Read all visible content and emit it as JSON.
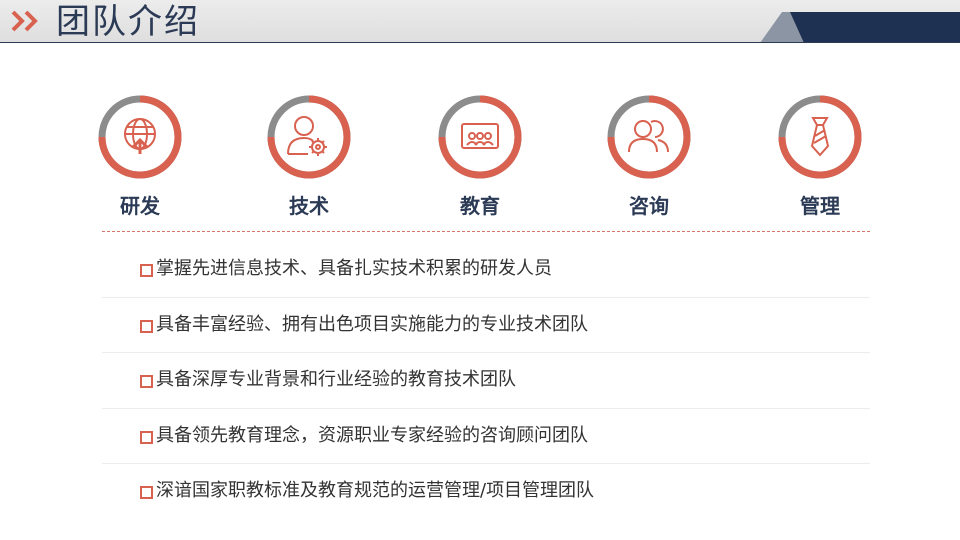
{
  "header": {
    "title": "团队介绍",
    "chevron_icon": "double-chevron-right-icon",
    "accent": "#d9614f",
    "dark": "#2b3a55"
  },
  "categories": [
    {
      "label": "研发",
      "icon": "globe-upload-icon"
    },
    {
      "label": "技术",
      "icon": "user-gear-icon"
    },
    {
      "label": "教育",
      "icon": "classroom-icon"
    },
    {
      "label": "咨询",
      "icon": "users-icon"
    },
    {
      "label": "管理",
      "icon": "necktie-icon"
    }
  ],
  "bullets": [
    "掌握先进信息技术、具备扎实技术积累的研发人员",
    "具备丰富经验、拥有出色项目实施能力的专业技术团队",
    "具备深厚专业背景和行业经验的教育技术团队",
    "具备领先教育理念，资源职业专家经验的咨询顾问团队",
    "深谙国家职教标准及教育规范的运营管理/项目管理团队"
  ],
  "colors": {
    "ring_red": "#d9614f",
    "ring_gray": "#8c8c8c",
    "text": "#333333"
  }
}
